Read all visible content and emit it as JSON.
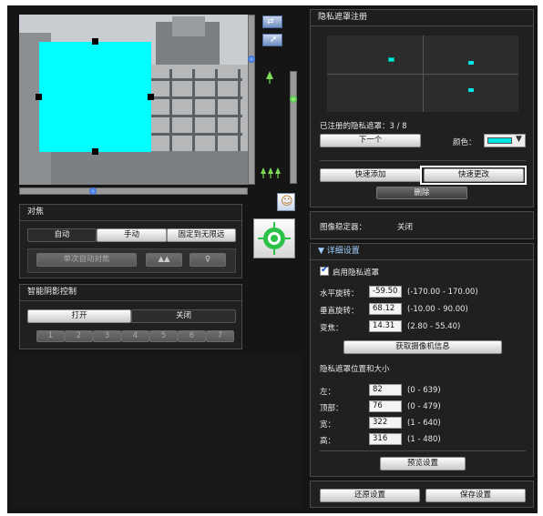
{
  "focus": {
    "title": "对焦",
    "modes": [
      "自动",
      "手动",
      "固定到无限远"
    ],
    "one_shot_af": "单次自动对焦"
  },
  "shadow": {
    "title": "智能阴影控制",
    "on": "打开",
    "off": "关闭",
    "levels": [
      "1",
      "2",
      "3",
      "4",
      "5",
      "6",
      "7"
    ]
  },
  "mask": {
    "title": "隐私遮罩注册",
    "registered_label": "已注册的隐私遮罩：3 / 8",
    "next": "下一个",
    "color_label": "颜色：",
    "color_value": "#00e6e6",
    "quick_add": "快速添加",
    "quick_change": "快速更改",
    "delete": "删除"
  },
  "stabilizer": {
    "label": "图像稳定器：",
    "value": "关闭"
  },
  "details": {
    "title": "▼ 详细设置",
    "enable_label": "启用隐私遮罩",
    "pan_label": "水平旋转：",
    "pan_value": "-59.50",
    "pan_range": "(-170.00 - 170.00)",
    "tilt_label": "垂直旋转：",
    "tilt_value": "68.12",
    "tilt_range": "(-10.00 - 90.00)",
    "zoom_label": "变焦：",
    "zoom_value": "14.31",
    "zoom_range": "(2.80 - 55.40)",
    "get_camera_info": "获取摄像机信息",
    "pos_size_title": "隐私遮罩位置和大小",
    "left_label": "左：",
    "left_value": "82",
    "left_range": "(0 - 639)",
    "top_label": "顶部：",
    "top_value": "76",
    "top_range": "(0 - 479)",
    "width_label": "宽：",
    "width_value": "322",
    "width_range": "(1 - 640)",
    "height_label": "高：",
    "height_value": "316",
    "height_range": "(1 - 480)",
    "preview": "预览设置"
  },
  "footer": {
    "restore": "还原设置",
    "save": "保存设置"
  }
}
